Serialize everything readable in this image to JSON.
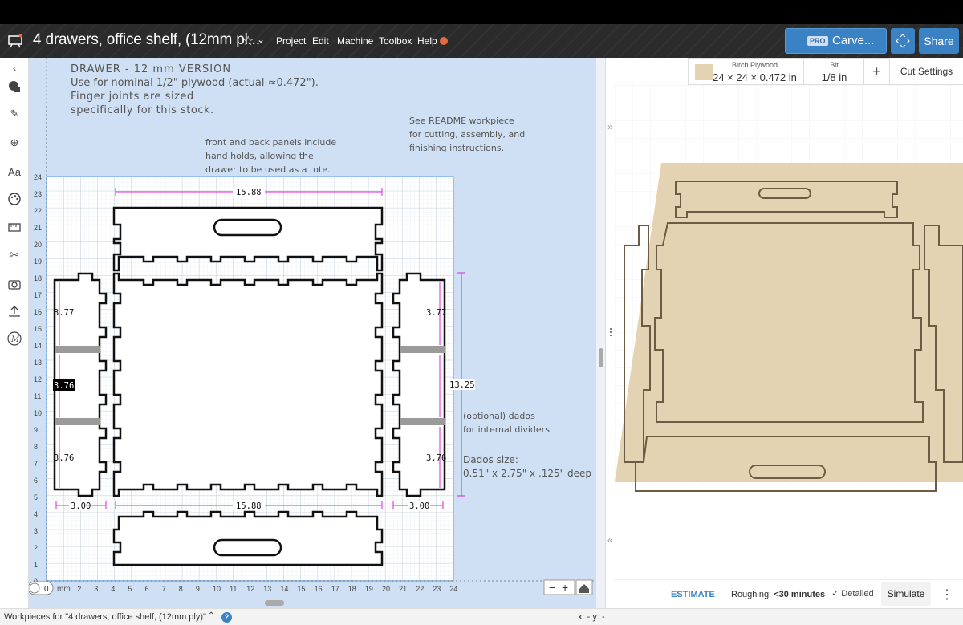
{
  "window": {
    "title": "4 drawers, office shelf, (12mm pl...",
    "menu": [
      "Project",
      "Edit",
      "Machine",
      "Toolbox",
      "Help"
    ],
    "carve_badge": "PRO",
    "carve_label": "Carve...",
    "share_label": "Share"
  },
  "toolbar": {
    "text_tool": "Aa"
  },
  "canvas": {
    "notes": {
      "title": "DRAWER - 12 mm VERSION",
      "line1": "Use for nominal 1/2\" plywood (actual ≈0.472\").",
      "line2": "Finger joints are sized",
      "line3": "specifically for this stock.",
      "front_back_1": "front and back panels include",
      "front_back_2": "hand holds, allowing the",
      "front_back_3": "drawer to be used as a tote.",
      "readme_1": "See README workpiece",
      "readme_2": "for cutting, assembly, and",
      "readme_3": "finishing instructions.",
      "dados_1": "(optional) dados",
      "dados_2": "for internal dividers",
      "dados_size_1": "Dados size:",
      "dados_size_2": "0.51\" x 2.75\" x .125\" deep"
    },
    "dimensions": {
      "top_width": "15.88",
      "bottom_width": "15.88",
      "left_top": "3.77",
      "left_mid": "3.76",
      "left_bottom": "3.76",
      "left_width": "3.00",
      "right_top": "3.77",
      "right_bottom": "3.76",
      "right_width": "3.00",
      "height": "13.25"
    },
    "y_ticks": [
      "24",
      "23",
      "22",
      "21",
      "20",
      "19",
      "18",
      "17",
      "16",
      "15",
      "14",
      "13",
      "12",
      "11",
      "10",
      "9",
      "8",
      "7",
      "6",
      "5",
      "4",
      "3",
      "2",
      "1",
      "0"
    ],
    "x_ticks": [
      "2",
      "3",
      "4",
      "5",
      "6",
      "7",
      "8",
      "9",
      "10",
      "11",
      "12",
      "13",
      "14",
      "15",
      "16",
      "17",
      "18",
      "19",
      "20",
      "21",
      "22",
      "23",
      "24"
    ],
    "unit_inch": "inch",
    "unit_mm": "mm",
    "unit_zero": "0",
    "zoom_out": "−",
    "zoom_in": "+"
  },
  "material": {
    "name": "Birch Plywood",
    "size": "24 × 24 × 0.472 in",
    "bit_label": "Bit",
    "bit_value": "1/8 in",
    "cut_settings": "Cut Settings"
  },
  "estimate": {
    "label": "ESTIMATE",
    "roughing_label": "Roughing:",
    "roughing_value": "<30 minutes",
    "detailed": "Detailed",
    "simulate": "Simulate"
  },
  "status": {
    "workpieces": "Workpieces for \"4 drawers, office shelf, (12mm ply)\"",
    "coords": "x: - y: -"
  },
  "colors": {
    "accent": "#3b82c4",
    "canvas_bg": "#cfe0f5",
    "dimension": "#e020e0",
    "dado": "#9a9a9a",
    "wood": "#e4d3b3"
  }
}
